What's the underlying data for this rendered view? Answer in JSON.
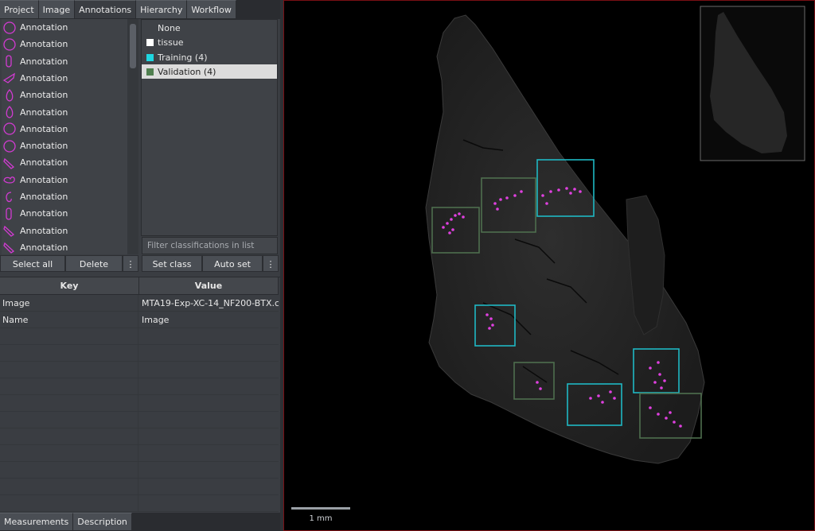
{
  "tabs": [
    "Project",
    "Image",
    "Annotations",
    "Hierarchy",
    "Workflow"
  ],
  "annotations": {
    "items": [
      {
        "label": "Annotation",
        "shape": "ring"
      },
      {
        "label": "Annotation",
        "shape": "ring"
      },
      {
        "label": "Annotation",
        "shape": "capsule"
      },
      {
        "label": "Annotation",
        "shape": "wedge"
      },
      {
        "label": "Annotation",
        "shape": "teardrop"
      },
      {
        "label": "Annotation",
        "shape": "teardrop"
      },
      {
        "label": "Annotation",
        "shape": "ring"
      },
      {
        "label": "Annotation",
        "shape": "ring"
      },
      {
        "label": "Annotation",
        "shape": "diagonal"
      },
      {
        "label": "Annotation",
        "shape": "blob"
      },
      {
        "label": "Annotation",
        "shape": "hook"
      },
      {
        "label": "Annotation",
        "shape": "capsule"
      },
      {
        "label": "Annotation",
        "shape": "diagonal"
      },
      {
        "label": "Annotation",
        "shape": "diagonal"
      }
    ],
    "shape_color": "#d23bd2",
    "select_all_label": "Select all",
    "delete_label": "Delete",
    "more_label": "⋮"
  },
  "classifications": {
    "items": [
      {
        "label": "None",
        "color": ""
      },
      {
        "label": "tissue",
        "color": "#ffffff"
      },
      {
        "label": "Training (4)",
        "color": "#1fd6e0"
      },
      {
        "label": "Validation (4)",
        "color": "#4f7f4f"
      }
    ],
    "selected_index": 3,
    "filter_placeholder": "Filter classifications in list",
    "set_class_label": "Set class",
    "auto_set_label": "Auto set",
    "more_label": "⋮"
  },
  "properties": {
    "key_header": "Key",
    "value_header": "Value",
    "rows": [
      {
        "key": "Image",
        "value": "MTA19-Exp-XC-14_NF200-BTX.czi..."
      },
      {
        "key": "Name",
        "value": "Image"
      }
    ]
  },
  "bottom_tabs": [
    "Measurements",
    "Description"
  ],
  "viewer": {
    "scalebar_label": "1 mm",
    "training_color": "#1fb8c4",
    "validation_color": "#4e6e4e",
    "detection_color": "#e040e0",
    "overlay_color": "#7a0f14"
  }
}
